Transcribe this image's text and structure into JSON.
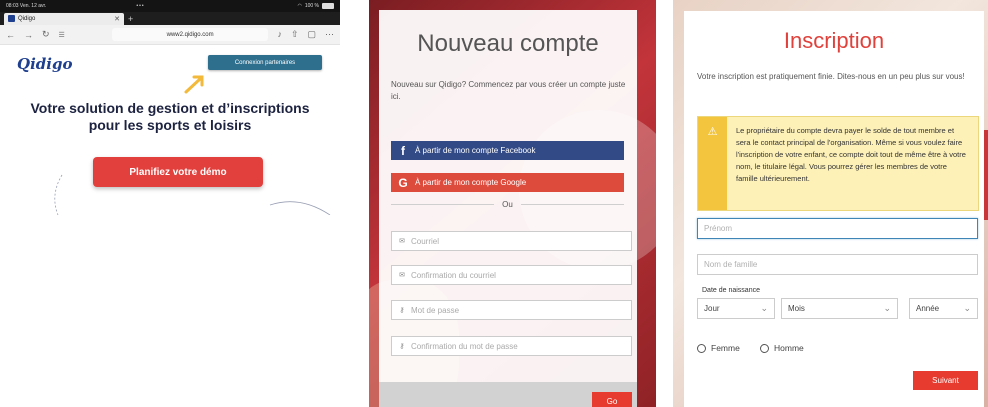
{
  "browser": {
    "status_time": "08:03 Ven. 12 avr.",
    "battery": "100 %",
    "tab_title": "Qidigo",
    "url": "www2.qidigo.com"
  },
  "landing": {
    "logo_text": "Qidigo",
    "partners_button": "Connexion partenaires",
    "headline_line1": "Votre solution de gestion et d’inscriptions",
    "headline_line2": "pour les sports et loisirs",
    "demo_button": "Planifiez votre démo"
  },
  "signup": {
    "title": "Nouveau compte",
    "intro": "Nouveau sur Qidigo? Commencez par vous créer un compte juste ici.",
    "facebook_button": "À partir de mon compte Facebook",
    "google_button": "À partir de mon compte Google",
    "separator": "Ou",
    "fields": {
      "email": "Courriel",
      "email_confirm": "Confirmation du courriel",
      "password": "Mot de passe",
      "password_confirm": "Confirmation du mot de passe"
    },
    "go_button": "Go"
  },
  "inscription": {
    "title": "Inscription",
    "intro": "Votre inscription est pratiquement finie. Dites-nous en un peu plus sur vous!",
    "warning": "Le propriétaire du compte devra payer le solde de tout membre et sera le contact principal de l'organisation. Même si vous voulez faire l'inscription de votre enfant, ce compte doit tout de même être à votre nom, le titulaire légal. Vous pourrez gérer les membres de votre famille ultérieurement.",
    "first_name_placeholder": "Prénom",
    "last_name_placeholder": "Nom de famille",
    "dob_label": "Date de naissance",
    "day_select": "Jour",
    "month_select": "Mois",
    "year_select": "Année",
    "gender_female": "Femme",
    "gender_male": "Homme",
    "next_button": "Suivant"
  },
  "colors": {
    "brand_blue": "#1f3f8f",
    "brand_red": "#e2403d",
    "facebook": "#324a86",
    "google": "#dd4b3d"
  }
}
